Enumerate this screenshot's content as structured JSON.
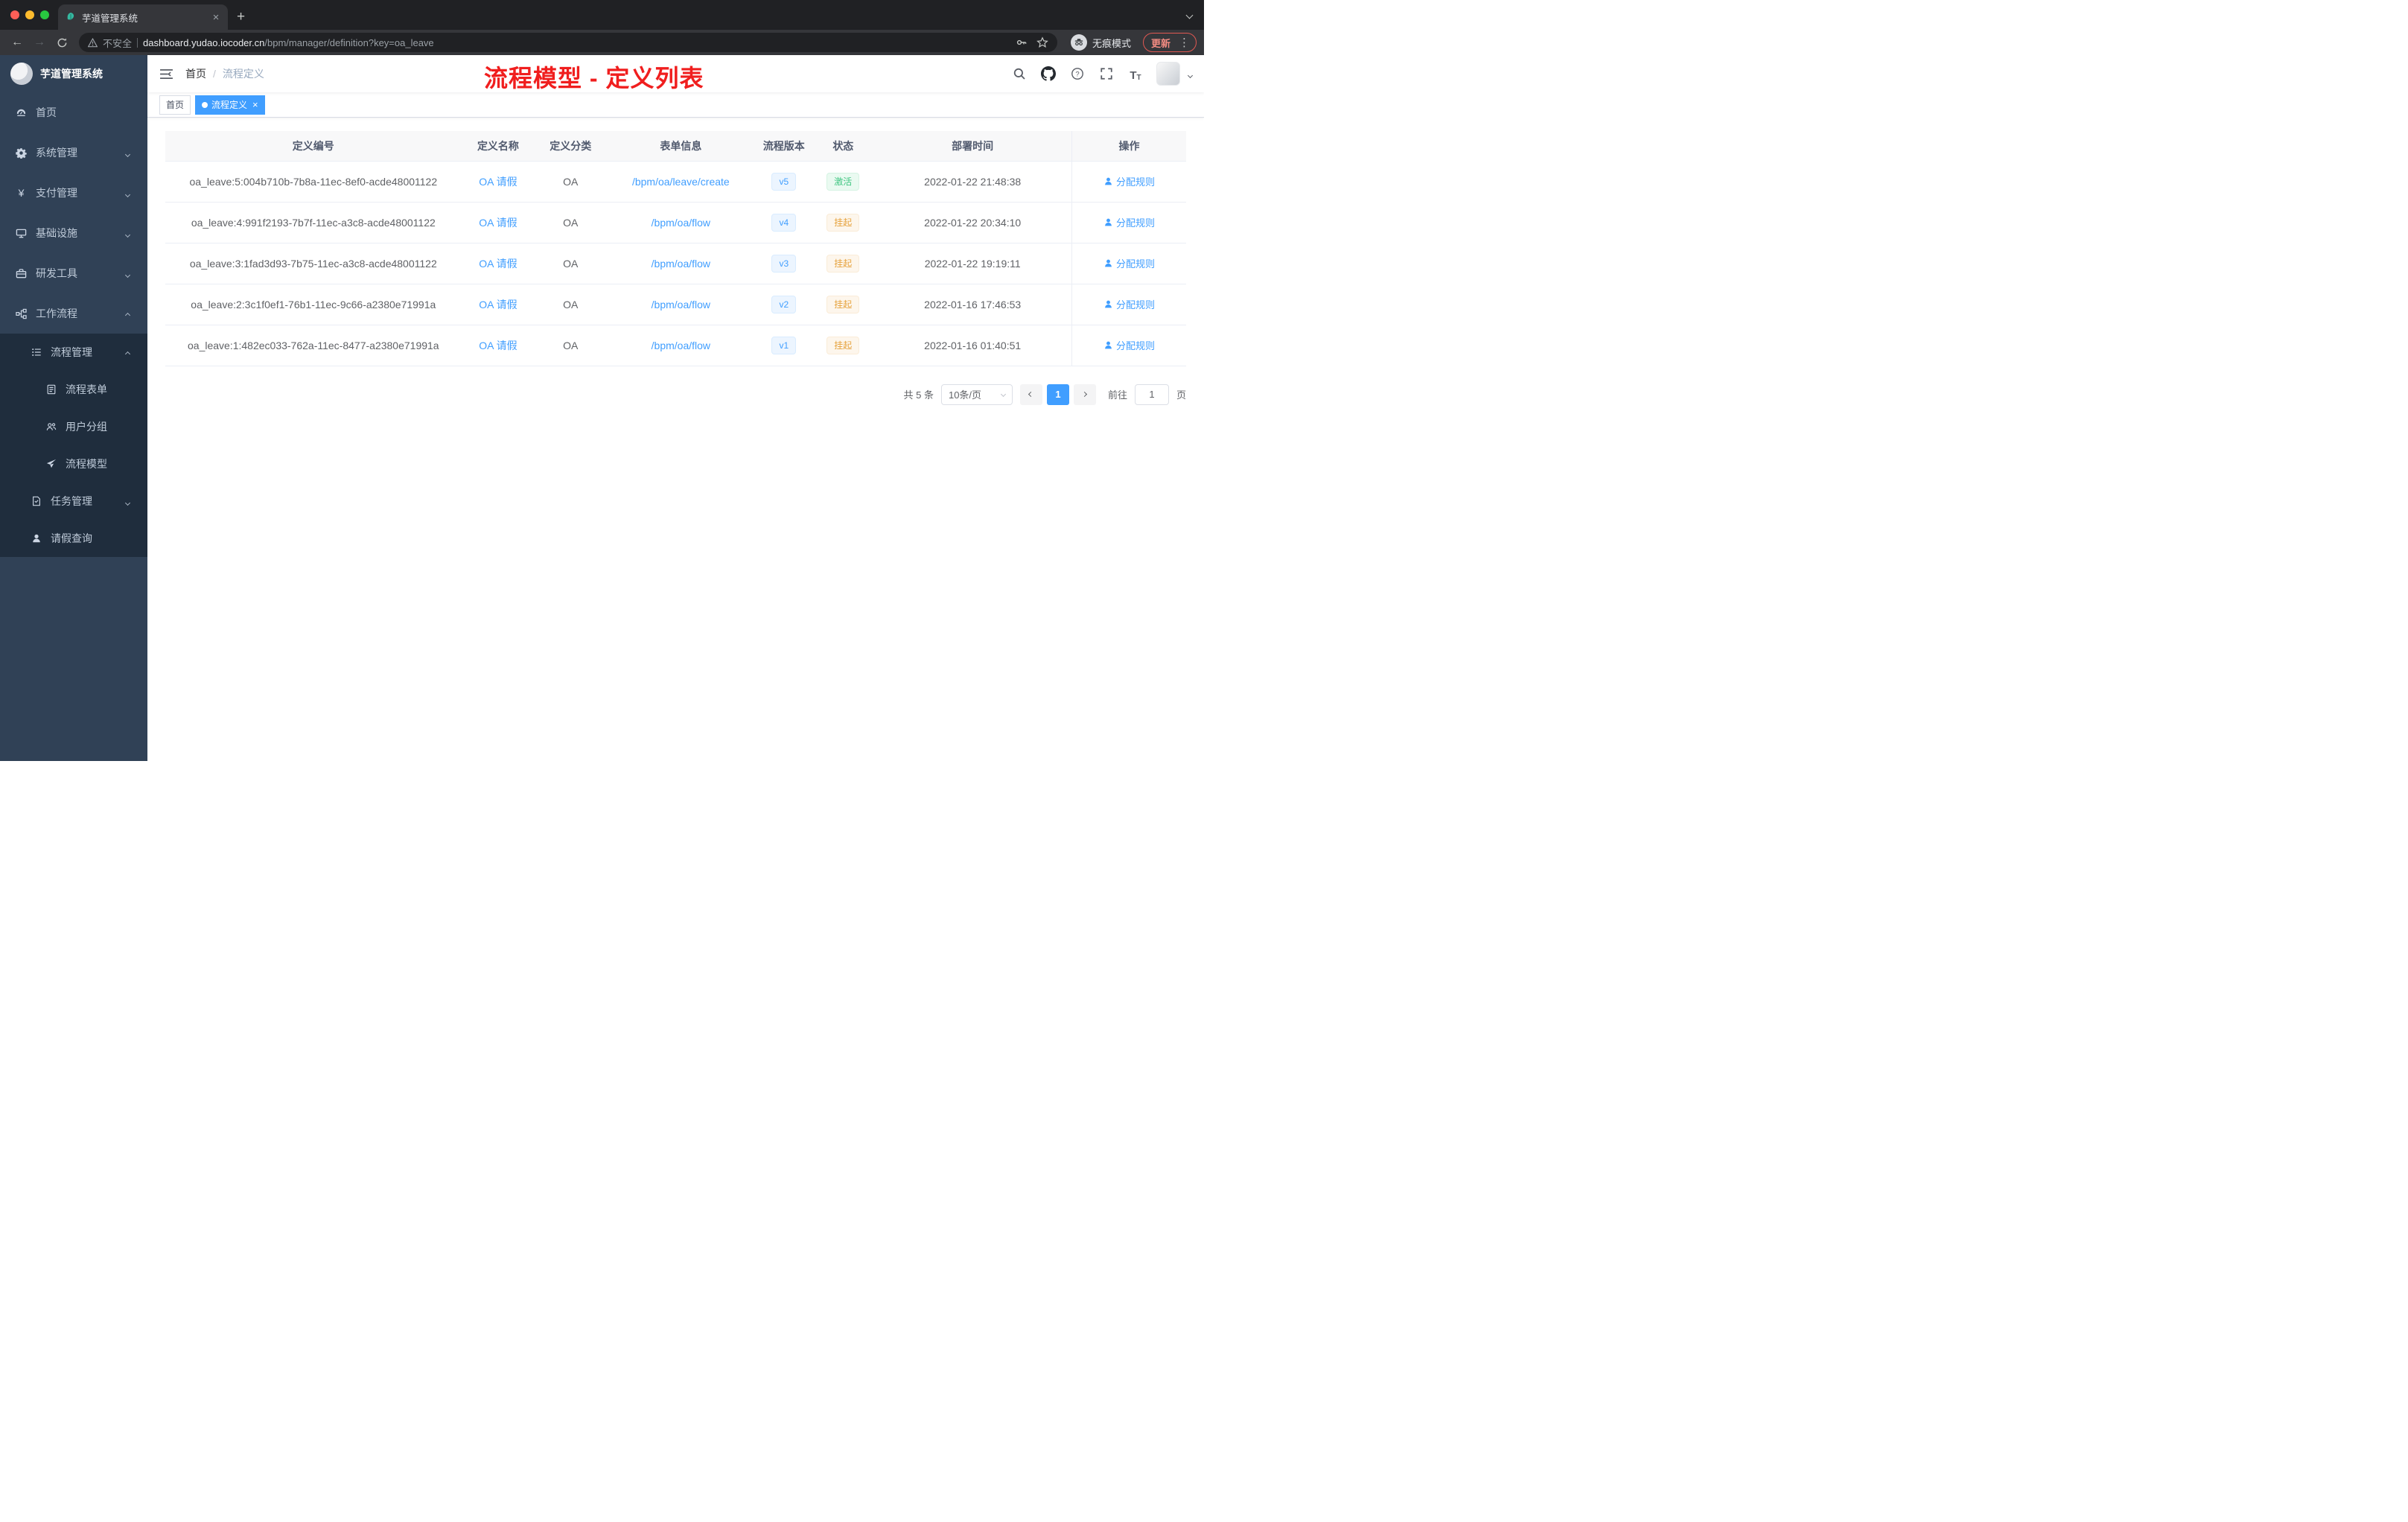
{
  "colors": {
    "primary": "#409eff",
    "success_text": "#3fc581",
    "warning_text": "#e6a23c",
    "annotation_red": "#f01e1e",
    "sidebar_bg": "#304156",
    "submenu_bg": "#1f2d3d",
    "active_tag_bg": "#409eff"
  },
  "icons": {
    "tab_favicon": "yudao-leaf",
    "navbar": [
      "search-icon",
      "github-icon",
      "help-icon",
      "fullscreen-icon",
      "font-size-icon"
    ],
    "action_icon": "user-icon"
  },
  "browser": {
    "tab": {
      "title": "芋道管理系统"
    },
    "address": {
      "security_label": "不安全",
      "domain": "dashboard.yudao.iocoder.cn",
      "path": "/bpm/manager/definition?key=oa_leave"
    },
    "incognito_label": "无痕模式",
    "update_label": "更新"
  },
  "sidebar": {
    "app_title": "芋道管理系统",
    "menu": [
      {
        "label": "首页",
        "icon": "dashboard-icon",
        "level": 1
      },
      {
        "label": "系统管理",
        "icon": "gear-icon",
        "level": 1,
        "expandable": true
      },
      {
        "label": "支付管理",
        "icon": "yen-icon",
        "level": 1,
        "expandable": true
      },
      {
        "label": "基础设施",
        "icon": "monitor-icon",
        "level": 1,
        "expandable": true
      },
      {
        "label": "研发工具",
        "icon": "toolbox-icon",
        "level": 1,
        "expandable": true
      },
      {
        "label": "工作流程",
        "icon": "workflow-icon",
        "level": 1,
        "expandable": true,
        "expanded": true
      },
      {
        "label": "流程管理",
        "icon": "list-icon",
        "level": 2,
        "expandable": true,
        "expanded": true
      },
      {
        "label": "流程表单",
        "icon": "form-icon",
        "level": 3
      },
      {
        "label": "用户分组",
        "icon": "user-group-icon",
        "level": 3
      },
      {
        "label": "流程模型",
        "icon": "paper-plane-icon",
        "level": 3
      },
      {
        "label": "任务管理",
        "icon": "task-icon",
        "level": 2,
        "expandable": true
      },
      {
        "label": "请假查询",
        "icon": "user-icon",
        "level": 2
      }
    ]
  },
  "header": {
    "breadcrumb": {
      "items": [
        "首页",
        "流程定义"
      ],
      "separator": "/"
    },
    "annotation_title": "流程模型 - 定义列表"
  },
  "tags_view": {
    "tags": [
      {
        "label": "首页",
        "active": false
      },
      {
        "label": "流程定义",
        "active": true
      }
    ]
  },
  "table": {
    "columns": [
      "定义编号",
      "定义名称",
      "定义分类",
      "表单信息",
      "流程版本",
      "状态",
      "部署时间",
      "操作"
    ],
    "rows": [
      {
        "id": "oa_leave:5:004b710b-7b8a-11ec-8ef0-acde48001122",
        "name": "OA 请假",
        "category": "OA",
        "form": "/bpm/oa/leave/create",
        "version": "v5",
        "status": "激活",
        "status_type": "success",
        "time": "2022-01-22 21:48:38",
        "action": "分配规则"
      },
      {
        "id": "oa_leave:4:991f2193-7b7f-11ec-a3c8-acde48001122",
        "name": "OA 请假",
        "category": "OA",
        "form": "/bpm/oa/flow",
        "version": "v4",
        "status": "挂起",
        "status_type": "warning",
        "time": "2022-01-22 20:34:10",
        "action": "分配规则"
      },
      {
        "id": "oa_leave:3:1fad3d93-7b75-11ec-a3c8-acde48001122",
        "name": "OA 请假",
        "category": "OA",
        "form": "/bpm/oa/flow",
        "version": "v3",
        "status": "挂起",
        "status_type": "warning",
        "time": "2022-01-22 19:19:11",
        "action": "分配规则"
      },
      {
        "id": "oa_leave:2:3c1f0ef1-76b1-11ec-9c66-a2380e71991a",
        "name": "OA 请假",
        "category": "OA",
        "form": "/bpm/oa/flow",
        "version": "v2",
        "status": "挂起",
        "status_type": "warning",
        "time": "2022-01-16 17:46:53",
        "action": "分配规则"
      },
      {
        "id": "oa_leave:1:482ec033-762a-11ec-8477-a2380e71991a",
        "name": "OA 请假",
        "category": "OA",
        "form": "/bpm/oa/flow",
        "version": "v1",
        "status": "挂起",
        "status_type": "warning",
        "time": "2022-01-16 01:40:51",
        "action": "分配规则"
      }
    ]
  },
  "pagination": {
    "total": "共 5 条",
    "page_size": "10条/页",
    "current_page": "1",
    "goto_prefix": "前往",
    "goto_value": "1",
    "goto_suffix": "页"
  }
}
